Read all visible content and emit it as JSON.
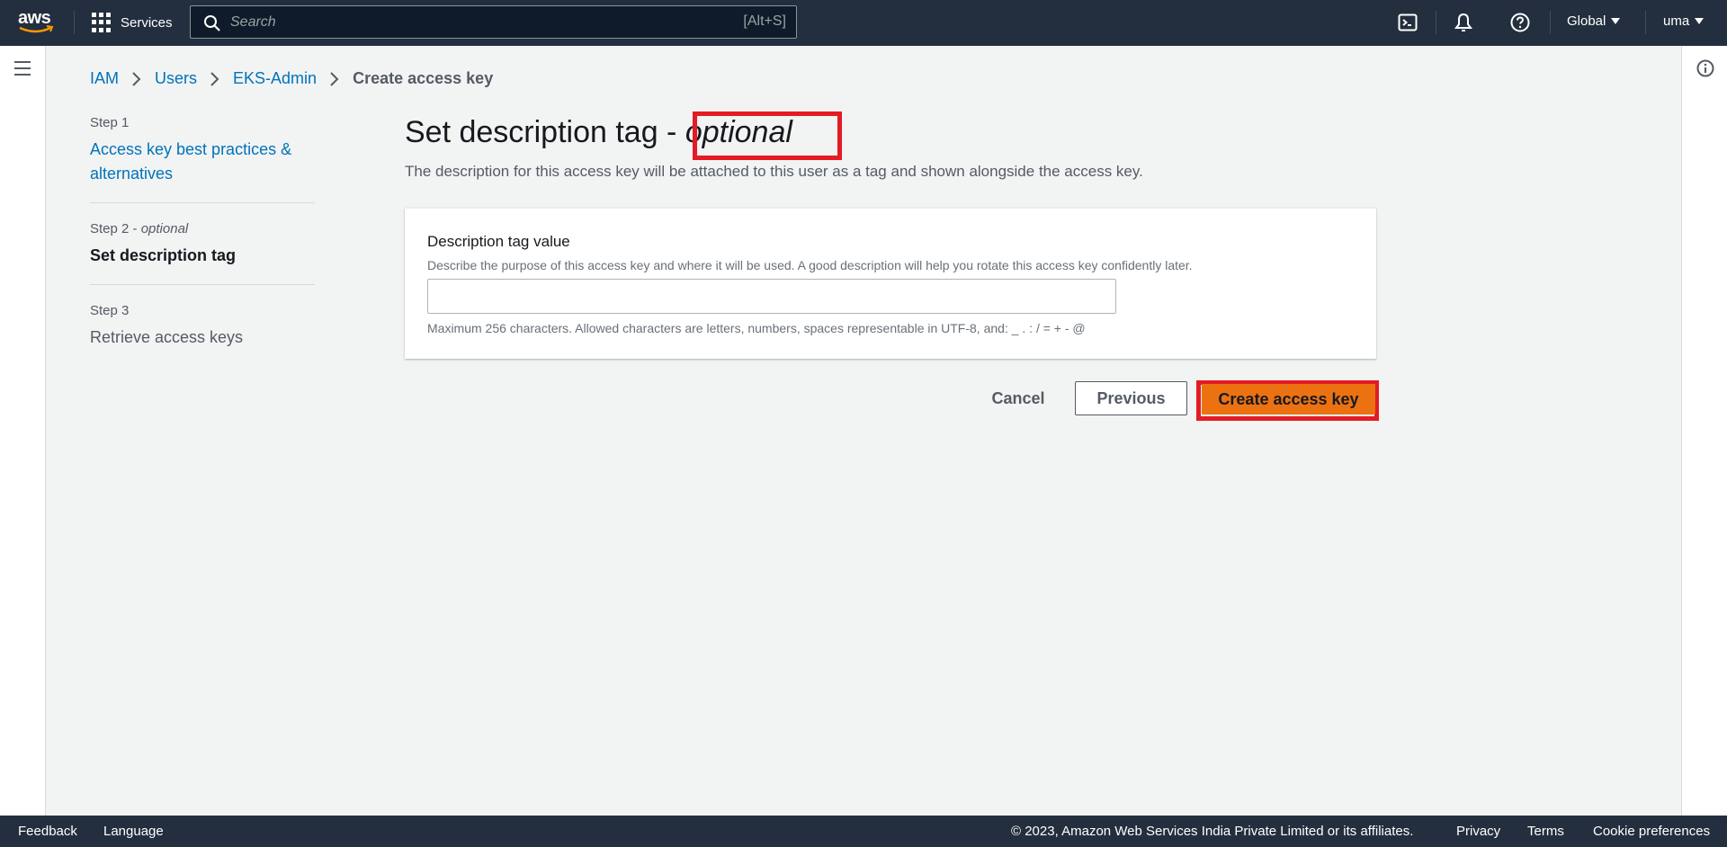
{
  "topnav": {
    "services_label": "Services",
    "search_placeholder": "Search",
    "search_shortcut": "[Alt+S]",
    "region_label": "Global",
    "account_label": "uma"
  },
  "breadcrumb": {
    "items": [
      "IAM",
      "Users",
      "EKS-Admin"
    ],
    "current": "Create access key"
  },
  "steps": [
    {
      "num": "Step 1",
      "num_suffix": "",
      "title": "Access key best practices & alternatives",
      "state": "link"
    },
    {
      "num": "Step 2 - ",
      "num_suffix": "optional",
      "title": "Set description tag",
      "state": "active"
    },
    {
      "num": "Step 3",
      "num_suffix": "",
      "title": "Retrieve access keys",
      "state": "disabled"
    }
  ],
  "main": {
    "heading": "Set description tag - ",
    "heading_optional": "optional",
    "description": "The description for this access key will be attached to this user as a tag and shown alongside the access key."
  },
  "form": {
    "label": "Description tag value",
    "description": "Describe the purpose of this access key and where it will be used. A good description will help you rotate this access key confidently later.",
    "value": "",
    "constraint": "Maximum 256 characters. Allowed characters are letters, numbers, spaces representable in UTF-8, and: _ . : / = + - @"
  },
  "actions": {
    "cancel": "Cancel",
    "previous": "Previous",
    "create": "Create access key"
  },
  "footer": {
    "feedback": "Feedback",
    "language": "Language",
    "copyright": "© 2023, Amazon Web Services India Private Limited or its affiliates.",
    "privacy": "Privacy",
    "terms": "Terms",
    "cookies": "Cookie preferences"
  },
  "colors": {
    "nav_bg": "#232f3e",
    "link": "#0073bb",
    "primary_button": "#ec7211",
    "highlight": "#e41b23"
  }
}
